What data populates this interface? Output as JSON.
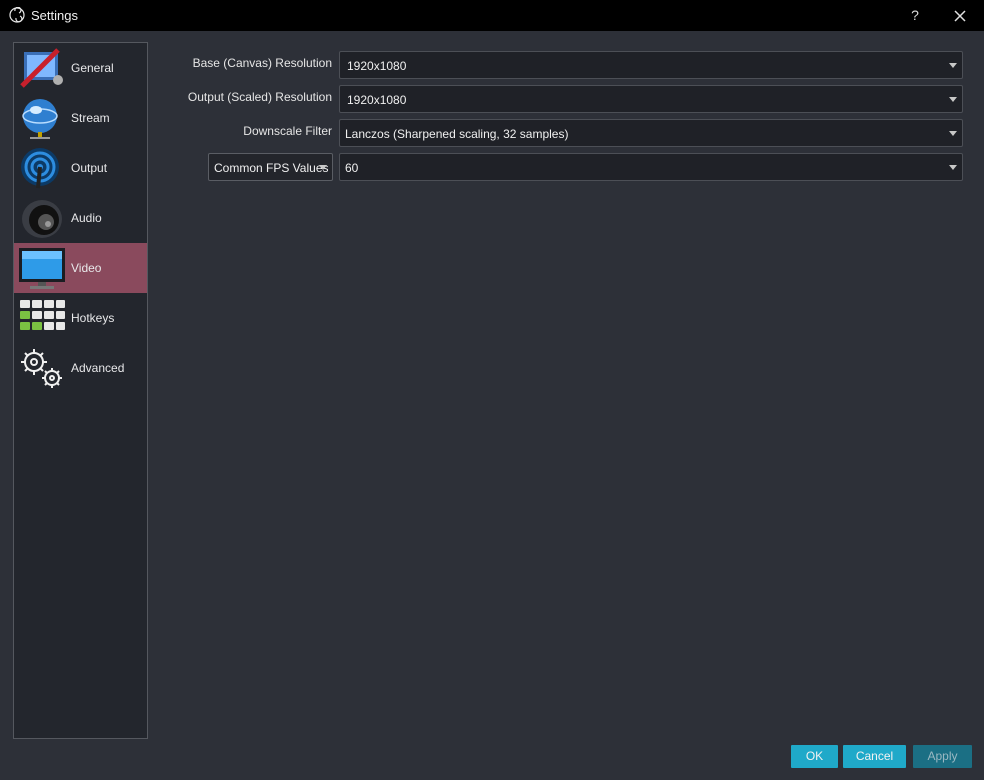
{
  "window": {
    "title": "Settings",
    "help_label": "?"
  },
  "sidebar": {
    "items": [
      {
        "label": "General",
        "icon": "general-icon"
      },
      {
        "label": "Stream",
        "icon": "globe-icon"
      },
      {
        "label": "Output",
        "icon": "broadcast-icon"
      },
      {
        "label": "Audio",
        "icon": "speaker-icon"
      },
      {
        "label": "Video",
        "icon": "monitor-icon",
        "active": true
      },
      {
        "label": "Hotkeys",
        "icon": "keyboard-icon"
      },
      {
        "label": "Advanced",
        "icon": "gears-icon"
      }
    ]
  },
  "video": {
    "base_resolution_label": "Base (Canvas) Resolution",
    "base_resolution_value": "1920x1080",
    "output_resolution_label": "Output (Scaled) Resolution",
    "output_resolution_value": "1920x1080",
    "downscale_filter_label": "Downscale Filter",
    "downscale_filter_value": "Lanczos (Sharpened scaling, 32 samples)",
    "fps_type_value": "Common FPS Values",
    "fps_value": "60"
  },
  "buttons": {
    "ok": "OK",
    "cancel": "Cancel",
    "apply": "Apply"
  },
  "colors": {
    "accent": "#1fa9c9",
    "selected": "#8a4a5d",
    "background": "#2d3038"
  }
}
